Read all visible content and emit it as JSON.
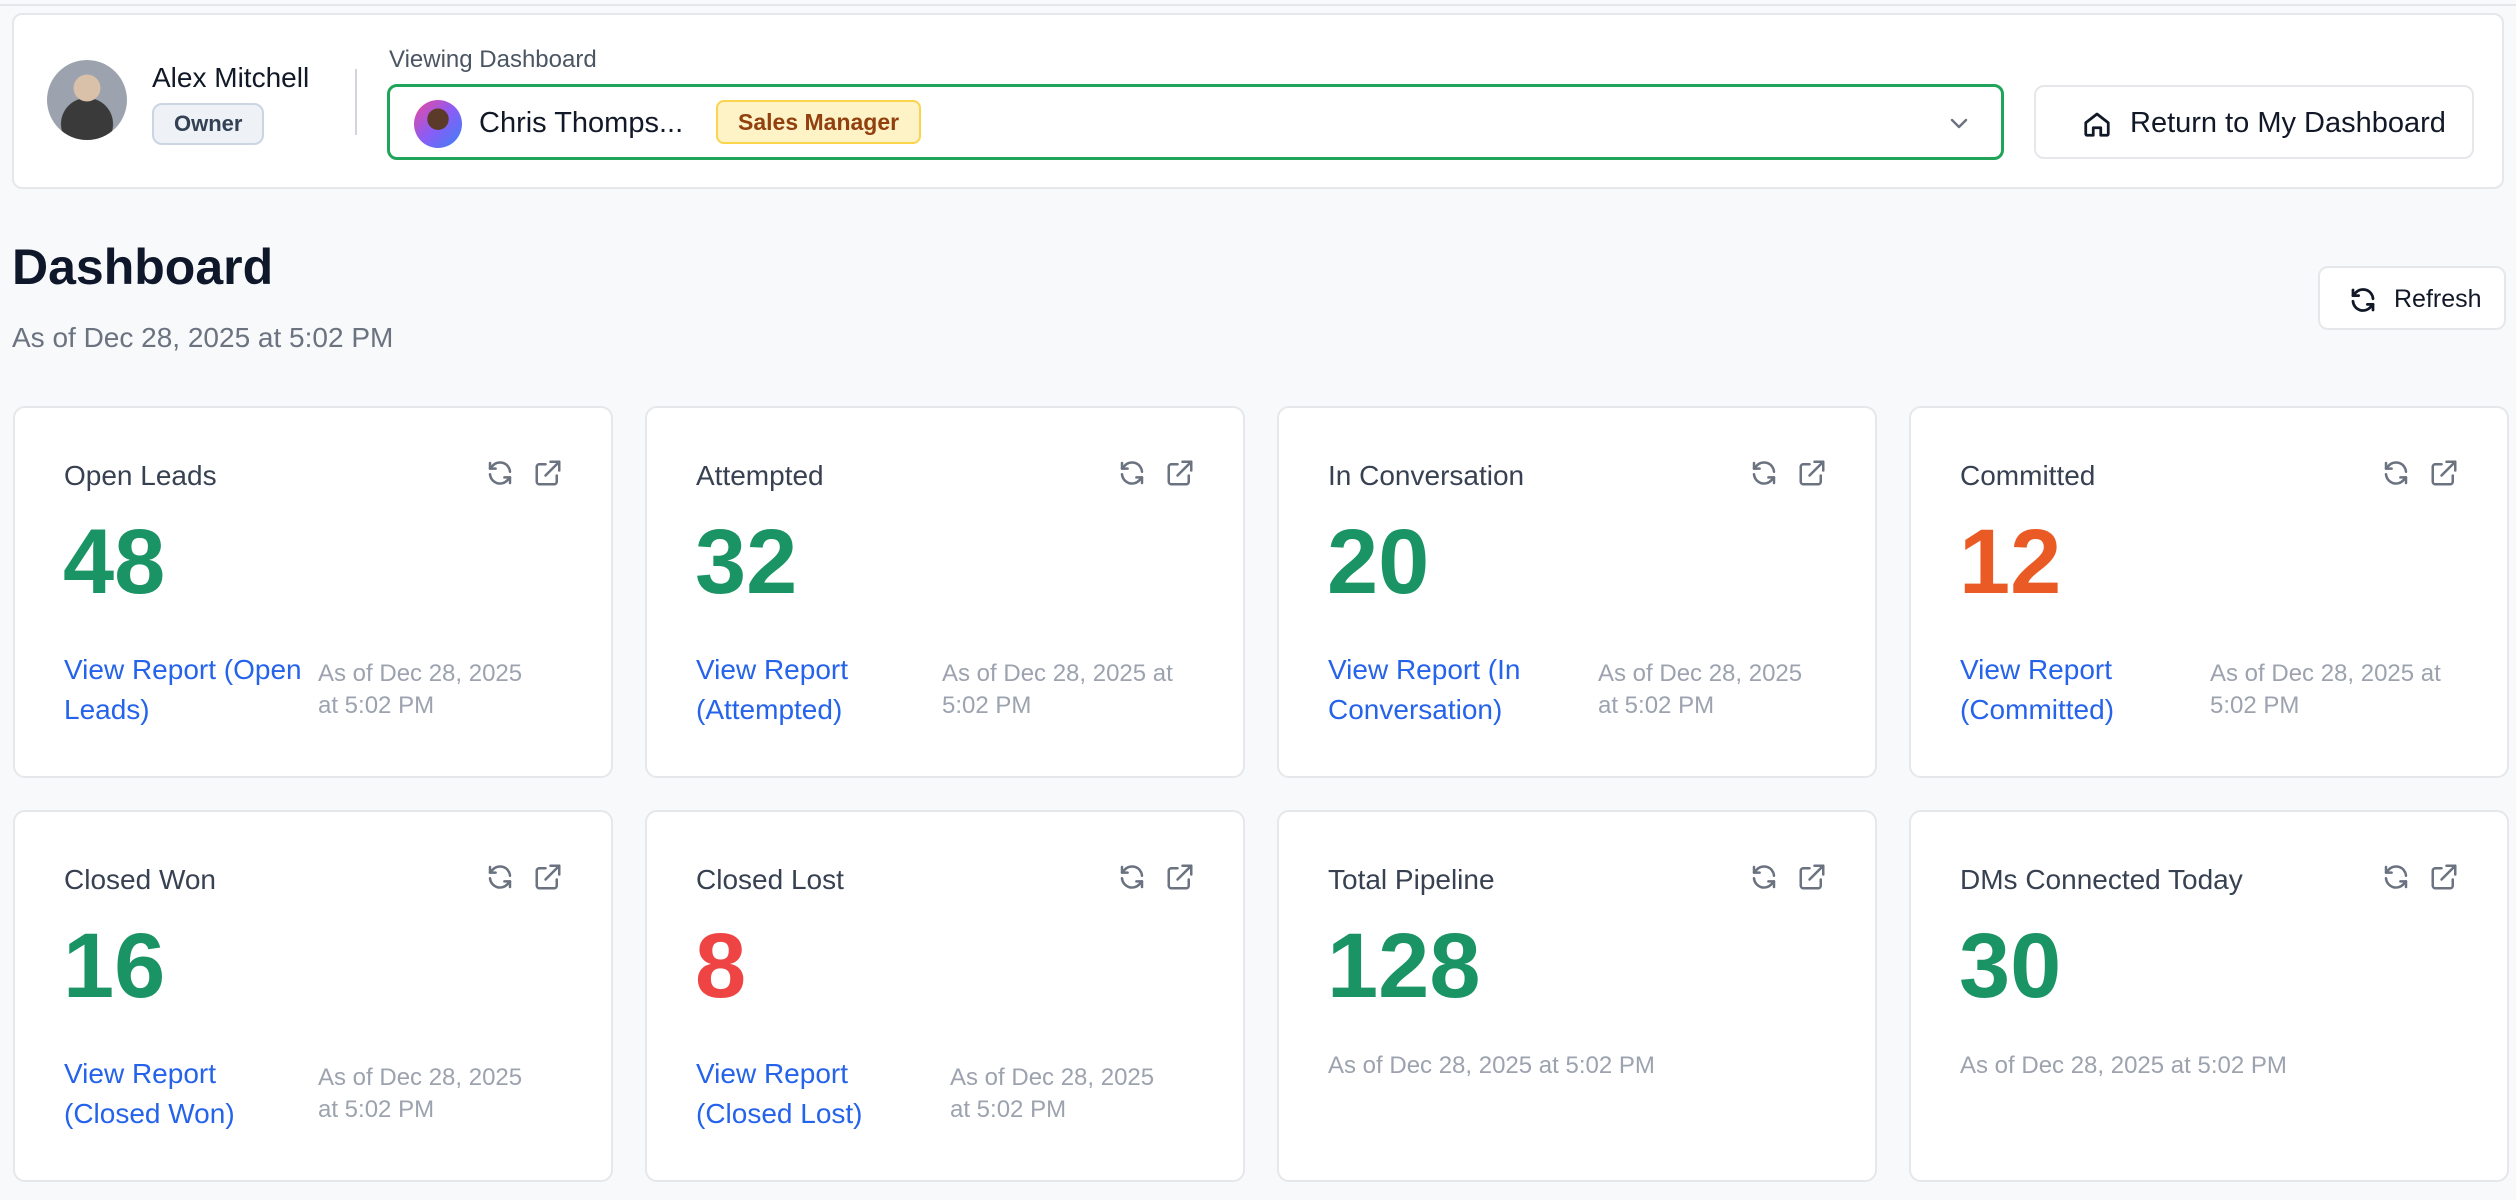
{
  "header": {
    "owner_name": "Alex Mitchell",
    "owner_role": "Owner",
    "viewing_label": "Viewing Dashboard",
    "viewing_user_name": "Chris Thomps...",
    "viewing_user_role": "Sales Manager",
    "return_label": "Return to My Dashboard"
  },
  "page": {
    "title": "Dashboard",
    "subtitle": "As of Dec 28, 2025 at 5:02 PM",
    "refresh_label": "Refresh"
  },
  "cards": [
    {
      "title": "Open Leads",
      "value": "48",
      "color": "#1a9464",
      "link": "View Report (Open Leads)",
      "time": "As of Dec 28, 2025 at 5:02 PM"
    },
    {
      "title": "Attempted",
      "value": "32",
      "color": "#1a9464",
      "link": "View Report (Attempted)",
      "time": "As of Dec 28, 2025 at 5:02 PM"
    },
    {
      "title": "In Conversation",
      "value": "20",
      "color": "#1a9464",
      "link": "View Report (In Conversation)",
      "time": "As of Dec 28, 2025 at 5:02 PM"
    },
    {
      "title": "Committed",
      "value": "12",
      "color": "#ea5a24",
      "link": "View Report (Committed)",
      "time": "As of Dec 28, 2025 at 5:02 PM"
    },
    {
      "title": "Closed Won",
      "value": "16",
      "color": "#1a9464",
      "link": "View Report (Closed Won)",
      "time": "As of Dec 28, 2025 at 5:02 PM"
    },
    {
      "title": "Closed Lost",
      "value": "8",
      "color": "#ef4444",
      "link": "View Report (Closed Lost)",
      "time": "As of Dec 28, 2025 at 5:02 PM"
    },
    {
      "title": "Total Pipeline",
      "value": "128",
      "color": "#1a9464",
      "time": "As of Dec 28, 2025 at 5:02 PM"
    },
    {
      "title": "DMs Connected Today",
      "value": "30",
      "color": "#1a9464",
      "time": "As of Dec 28, 2025 at 5:02 PM"
    }
  ],
  "icons": {
    "card_refresh": "refresh-icon",
    "card_open": "external-link-icon",
    "return": "home-icon",
    "dropdown": "chevron-down-icon"
  }
}
